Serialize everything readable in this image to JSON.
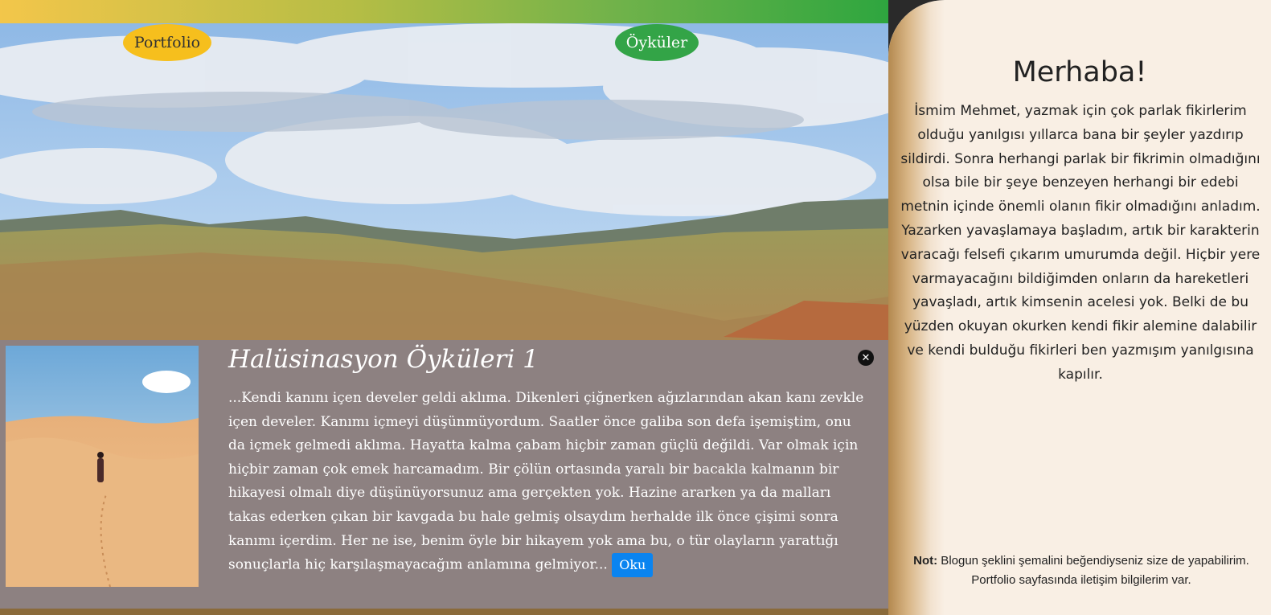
{
  "nav": {
    "portfolio_label": "Portfolio",
    "stories_label": "Öyküler"
  },
  "story_card": {
    "title": "Halüsinasyon Öyküleri 1",
    "excerpt": "...Kendi kanını içen develer geldi aklıma. Dikenleri çiğnerken ağızlarından akan kanı zevkle içen develer. Kanımı içmeyi düşünmüyordum. Saatler önce galiba son defa işemiştim, onu da içmek gelmedi aklıma. Hayatta kalma çabam hiçbir zaman güçlü değildi. Var olmak için hiçbir zaman çok emek harcamadım. Bir çölün ortasında yaralı bir bacakla kalmanın bir hikayesi olmalı diye düşünüyorsunuz ama gerçekten yok. Hazine ararken ya da malları takas ederken çıkan bir kavgada bu hale gelmiş olsaydım herhalde ilk önce çişimi sonra kanımı içerdim. Her ne ise, benim öyle bir hikayem yok ama bu, o tür olayların yarattığı sonuçlarla hiç karşılaşmayacağım anlamına gelmiyor...",
    "read_button": "Oku",
    "close_icon": "close-circle-icon"
  },
  "sidebar": {
    "title": "Merhaba!",
    "bio": "İsmim Mehmet, yazmak için çok parlak fikirlerim olduğu yanılgısı yıllarca bana bir şeyler yazdırıp sildirdi. Sonra herhangi parlak bir fikrimin olmadığını olsa bile bir şeye benzeyen herhangi bir edebi metnin içinde önemli olanın fikir olmadığını anladım. Yazarken yavaşlamaya başladım, artık bir karakterin varacağı felsefi çıkarım umurumda değil. Hiçbir yere varmayacağını bildiğimden onların da hareketleri yavaşladı, artık kimsenin acelesi yok. Belki de bu yüzden okuyan okurken kendi fikir alemine dalabilir ve kendi bulduğu fikirleri ben yazmışım yanılgısına kapılır.",
    "note_label": "Not:",
    "note_text": " Blogun şeklini şemalini beğendiyseniz size de yapabilirim. Portfolio sayfasında iletişim bilgilerim var."
  },
  "colors": {
    "portfolio_pill": "#f6bf1d",
    "stories_pill": "#33a447",
    "card_bg": "#8d8181",
    "read_button": "#0a84f0",
    "sidebar_bg": "#f9efe4"
  }
}
